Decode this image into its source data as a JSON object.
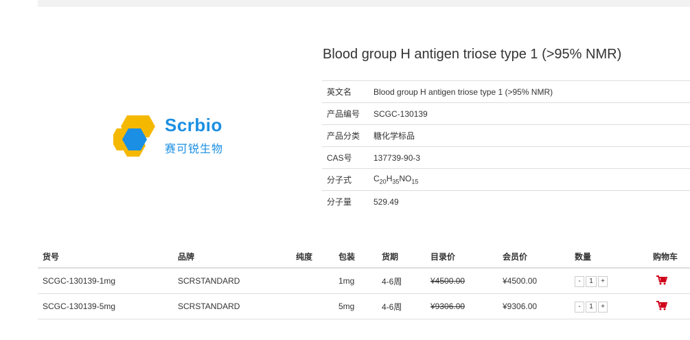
{
  "product": {
    "title": "Blood group H antigen triose type 1 (>95% NMR)",
    "logo": {
      "en": "Scrbio",
      "cn": "赛可锐生物"
    },
    "specs": [
      {
        "key": "英文名",
        "value": "Blood group H antigen triose type 1 (>95% NMR)"
      },
      {
        "key": "产品编号",
        "value": "SCGC-130139"
      },
      {
        "key": "产品分类",
        "value": "糖化学标品"
      },
      {
        "key": "CAS号",
        "value": "137739-90-3"
      },
      {
        "key": "分子式",
        "formula": {
          "c": "C",
          "c_n": "20",
          "h": "H",
          "h_n": "35",
          "no": "NO",
          "no_n": "15"
        }
      },
      {
        "key": "分子量",
        "value": "529.49"
      }
    ]
  },
  "table": {
    "headers": [
      "货号",
      "品牌",
      "纯度",
      "包装",
      "货期",
      "目录价",
      "会员价",
      "数量",
      "购物车"
    ],
    "rows": [
      {
        "sku": "SCGC-130139-1mg",
        "brand": "SCRSTANDARD",
        "purity": "",
        "pack": "1mg",
        "lead": "4-6周",
        "list_price": "¥4500.00",
        "member_price": "¥4500.00",
        "minus": "-",
        "qty": "1",
        "plus": "+"
      },
      {
        "sku": "SCGC-130139-5mg",
        "brand": "SCRSTANDARD",
        "purity": "",
        "pack": "5mg",
        "lead": "4-6周",
        "list_price": "¥9306.00",
        "member_price": "¥9306.00",
        "minus": "-",
        "qty": "1",
        "plus": "+"
      }
    ]
  },
  "colors": {
    "brand_blue": "#1a8fe3",
    "logo_yellow": "#f5b800",
    "price_red": "#d0021b"
  },
  "icons": {
    "cart": "cart-icon"
  }
}
